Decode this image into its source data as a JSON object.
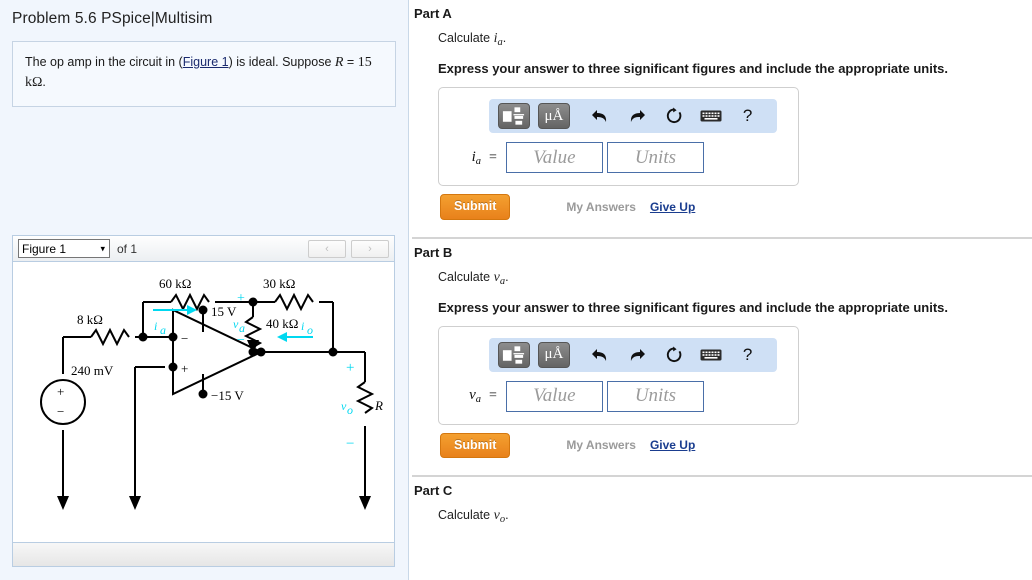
{
  "problem": {
    "title": "Problem 5.6 PSpice|Multisim",
    "statement_pre": "The op amp in the circuit in (",
    "statement_link": "Figure 1",
    "statement_mid": ") is ideal. Suppose ",
    "statement_var": "R",
    "statement_eq": " =",
    "statement_value": "15 kΩ",
    "statement_period": "."
  },
  "figure_widget": {
    "selected": "Figure 1",
    "caret": "▾",
    "of_label": "of 1",
    "prev_label": "‹",
    "next_label": "›"
  },
  "circuit": {
    "r_8k": "8 kΩ",
    "r_60k": "60 kΩ",
    "r_30k": "30 kΩ",
    "r_40k": "40 kΩ",
    "r_load": "R",
    "source": "240 mV",
    "vplus": "15 V",
    "vminus": "−15 V",
    "op_minus": "−",
    "op_plus": "+",
    "label_ia": "i",
    "label_ia_sub": "a",
    "label_va": "v",
    "label_va_sub": "a",
    "label_io": "i",
    "label_io_sub": "o",
    "label_vo": "v",
    "label_vo_sub": "o",
    "polarity_plus": "+",
    "polarity_minus": "−",
    "src_plus": "+",
    "src_minus": "−"
  },
  "toolbar_icons": {
    "template": "template-icon",
    "units": "μÅ",
    "undo": "↩",
    "redo": "↪",
    "reset": "⟳",
    "keyboard": "keyboard-icon",
    "help": "?"
  },
  "parts": [
    {
      "heading": "Part A",
      "calculate_pre": "Calculate ",
      "calculate_var": "i",
      "calculate_sub": "a",
      "calculate_post": ".",
      "express": "Express your answer to three significant figures and include the appropriate units.",
      "eq_var": "i",
      "eq_sub": "a",
      "eq_sign": "=",
      "value_placeholder": "Value",
      "units_placeholder": "Units",
      "submit_label": "Submit",
      "my_answers_label": "My Answers",
      "give_up_label": "Give Up"
    },
    {
      "heading": "Part B",
      "calculate_pre": "Calculate ",
      "calculate_var": "v",
      "calculate_sub": "a",
      "calculate_post": ".",
      "express": "Express your answer to three significant figures and include the appropriate units.",
      "eq_var": "v",
      "eq_sub": "a",
      "eq_sign": "=",
      "value_placeholder": "Value",
      "units_placeholder": "Units",
      "submit_label": "Submit",
      "my_answers_label": "My Answers",
      "give_up_label": "Give Up"
    },
    {
      "heading": "Part C",
      "calculate_pre": "Calculate ",
      "calculate_var": "v",
      "calculate_sub": "o",
      "calculate_post": "."
    }
  ],
  "colors": {
    "left_bg": "#f1f6fd",
    "toolbar_bg": "#cfe0f5",
    "submit_orange": "#ec8a1e",
    "link_blue": "#1a3d8f",
    "circuit_cyan": "#00d8f0"
  }
}
